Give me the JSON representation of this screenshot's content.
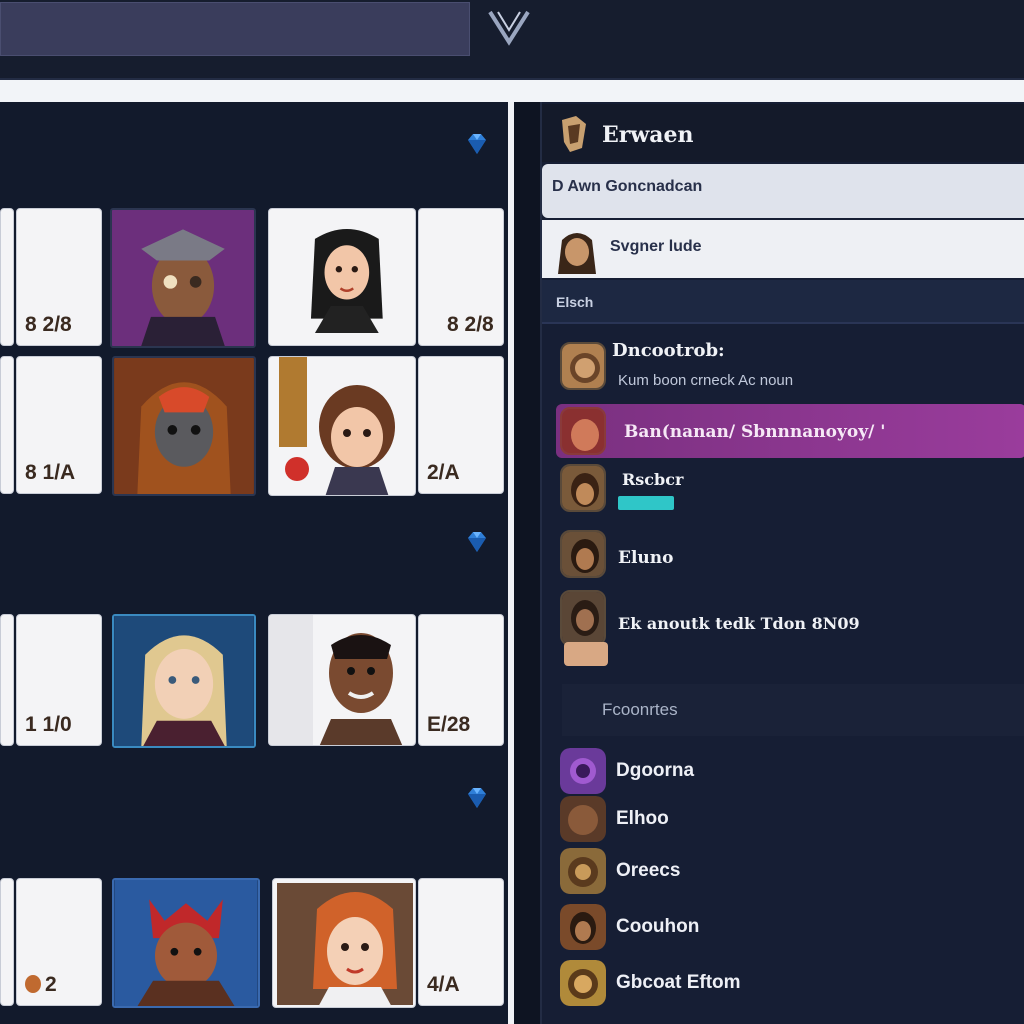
{
  "topbar": {
    "search_value": "",
    "chevron_icon": "chevron-down-icon"
  },
  "cards": [
    {
      "cost": "8 2/8",
      "badge": false
    },
    {
      "cost": "",
      "badge": false
    },
    {
      "cost": "8 2/8",
      "badge": true
    },
    {
      "cost": "8 1/A",
      "badge": false
    },
    {
      "cost": "",
      "badge": false
    },
    {
      "cost": "2/A",
      "badge": false
    },
    {
      "cost": "1 1/0",
      "badge": false
    },
    {
      "cost": "",
      "badge": false
    },
    {
      "cost": "E/28",
      "badge": false
    },
    {
      "cost": "2",
      "badge": true
    },
    {
      "cost": "",
      "badge": false
    },
    {
      "cost": "4/A",
      "badge": false
    }
  ],
  "right": {
    "header_title": "Erwaen",
    "row1": "D Awn Goncnadcan",
    "row2": "Svgner lude",
    "section": "Elsch",
    "items": [
      {
        "name": "Dncootrob:",
        "sub": "Kum boon   crneck Ac noun"
      },
      {
        "name": "Ban(nanan/ Sbnnnanoyoy/ '",
        "sub": ""
      },
      {
        "name": "Rscbcr",
        "sub": ""
      },
      {
        "name": "Eluno",
        "sub": ""
      },
      {
        "name": "Ek anoutk tedk  Tdon  8N09",
        "sub": ""
      }
    ],
    "footer_label": "Fcoonrtes",
    "footer_items": [
      {
        "name": "Dgoorna"
      },
      {
        "name": "Elhoo"
      },
      {
        "name": "Oreecs"
      },
      {
        "name": "Coouhon"
      },
      {
        "name": "Gbcoat Eftom"
      }
    ]
  }
}
